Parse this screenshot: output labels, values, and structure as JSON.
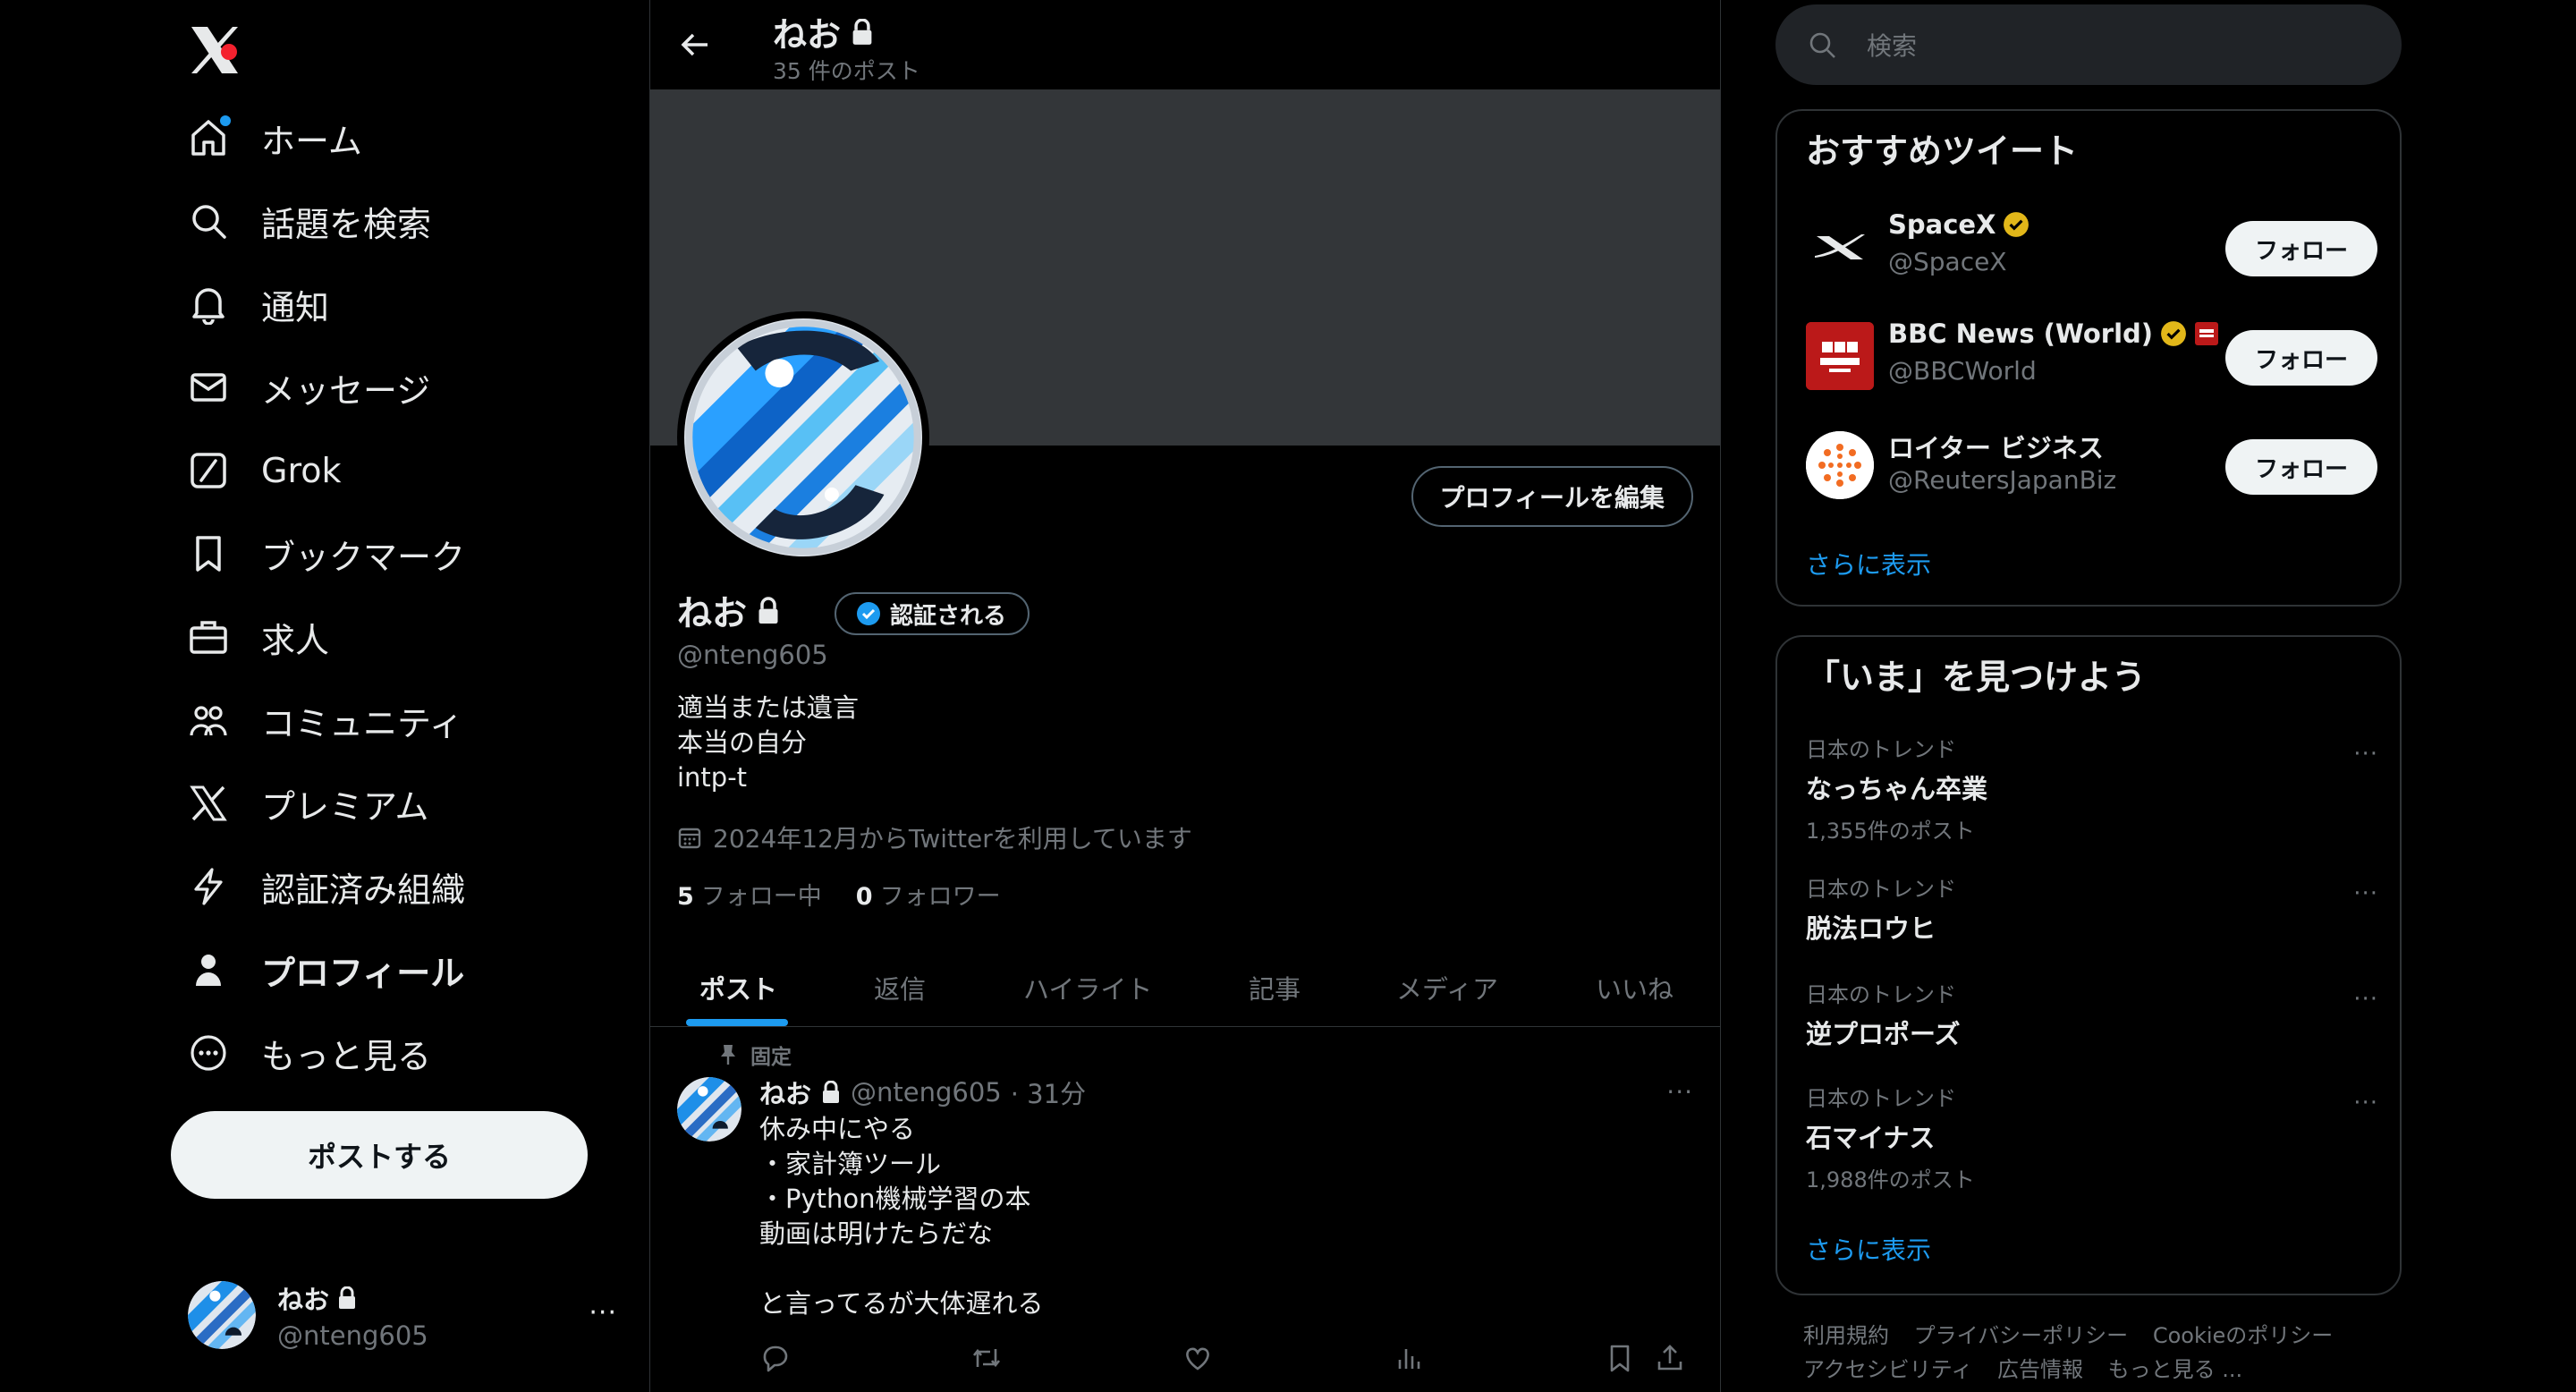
{
  "nav": {
    "items": [
      {
        "label": "ホーム",
        "icon": "home-icon"
      },
      {
        "label": "話題を検索",
        "icon": "search-icon"
      },
      {
        "label": "通知",
        "icon": "bell-icon"
      },
      {
        "label": "メッセージ",
        "icon": "mail-icon"
      },
      {
        "label": "Grok",
        "icon": "grok-icon"
      },
      {
        "label": "ブックマーク",
        "icon": "bookmark-icon"
      },
      {
        "label": "求人",
        "icon": "briefcase-icon"
      },
      {
        "label": "コミュニティ",
        "icon": "people-icon"
      },
      {
        "label": "プレミアム",
        "icon": "x-icon"
      },
      {
        "label": "認証済み組織",
        "icon": "lightning-icon"
      },
      {
        "label": "プロフィール",
        "icon": "person-icon"
      },
      {
        "label": "もっと見る",
        "icon": "more-circle-icon"
      }
    ],
    "post_button": "ポストする",
    "account": {
      "name": "ねお",
      "handle": "@nteng605",
      "more": "···"
    }
  },
  "header": {
    "name": "ねお",
    "post_count": "35 件のポスト"
  },
  "profile": {
    "edit_button": "プロフィールを編集",
    "name": "ねお",
    "verify_label": "認証される",
    "handle": "@nteng605",
    "bio": [
      "適当または遺言",
      "本当の自分",
      "intp-t"
    ],
    "joined": "2024年12月からTwitterを利用しています",
    "following_count": "5",
    "following_label": "フォロー中",
    "followers_count": "0",
    "followers_label": "フォロワー"
  },
  "tabs": [
    "ポスト",
    "返信",
    "ハイライト",
    "記事",
    "メディア",
    "いいね"
  ],
  "pinned_tweet": {
    "pinned_label": "固定",
    "name": "ねお",
    "handle": "@nteng605",
    "time": "· 31分",
    "more": "···",
    "text": "休み中にやる\n・家計簿ツール\n・Python機械学習の本\n動画は明けたらだな\n\nと言ってるが大体遅れる"
  },
  "search": {
    "placeholder": "検索"
  },
  "recommend": {
    "title": "おすすめツイート",
    "follow_label": "フォロー",
    "accounts": [
      {
        "name": "SpaceX",
        "handle": "@SpaceX"
      },
      {
        "name": "BBC News (World)",
        "handle": "@BBCWorld"
      },
      {
        "name": "ロイター ビジネス",
        "handle": "@ReutersJapanBiz"
      }
    ],
    "show_more": "さらに表示"
  },
  "trends": {
    "title": "「いま」を見つけよう",
    "items": [
      {
        "context": "日本のトレンド",
        "name": "なっちゃん卒業",
        "count": "1,355件のポスト"
      },
      {
        "context": "日本のトレンド",
        "name": "脱法ロウヒ",
        "count": ""
      },
      {
        "context": "日本のトレンド",
        "name": "逆プロポーズ",
        "count": ""
      },
      {
        "context": "日本のトレンド",
        "name": "石マイナス",
        "count": "1,988件のポスト"
      }
    ],
    "more": "···",
    "show_more": "さらに表示"
  },
  "footer": {
    "links": [
      "利用規約",
      "プライバシーポリシー",
      "Cookieのポリシー",
      "アクセシビリティ",
      "広告情報",
      "もっと見る ..."
    ]
  },
  "colors": {
    "accent": "#1d9bf0",
    "background": "#000000",
    "banner": "#333639",
    "gold_badge": "#e2b719",
    "muted": "#71767b"
  }
}
